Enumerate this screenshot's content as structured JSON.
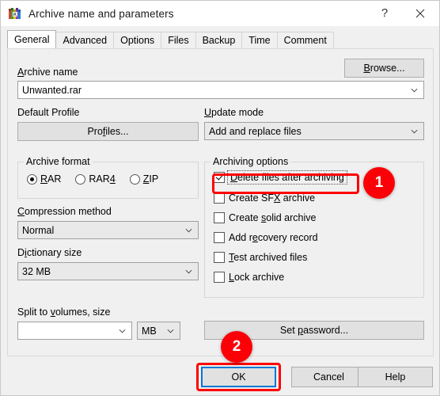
{
  "window": {
    "title": "Archive name and parameters",
    "icon": "winrar-books-icon",
    "help_button": "?",
    "close_button": "✕"
  },
  "tabs": [
    {
      "label": "General",
      "active": true
    },
    {
      "label": "Advanced",
      "active": false
    },
    {
      "label": "Options",
      "active": false
    },
    {
      "label": "Files",
      "active": false
    },
    {
      "label": "Backup",
      "active": false
    },
    {
      "label": "Time",
      "active": false
    },
    {
      "label": "Comment",
      "active": false
    }
  ],
  "archive_name": {
    "label": "Archive name",
    "value": "Unwanted.rar",
    "browse_button": "Browse..."
  },
  "default_profile": {
    "label": "Default Profile",
    "button": "Profiles..."
  },
  "update_mode": {
    "label": "Update mode",
    "value": "Add and replace files"
  },
  "archive_format": {
    "legend": "Archive format",
    "options": [
      {
        "label": "RAR",
        "selected": true
      },
      {
        "label": "RAR4",
        "selected": false
      },
      {
        "label": "ZIP",
        "selected": false
      }
    ]
  },
  "compression_method": {
    "label": "Compression method",
    "value": "Normal"
  },
  "dictionary_size": {
    "label": "Dictionary size",
    "value": "32 MB"
  },
  "split_volumes": {
    "label": "Split to volumes, size",
    "value": "",
    "unit": "MB"
  },
  "archiving_options": {
    "legend": "Archiving options",
    "items": [
      {
        "label": "Delete files after archiving",
        "checked": true,
        "focused": true
      },
      {
        "label": "Create SFX archive",
        "checked": false,
        "focused": false
      },
      {
        "label": "Create solid archive",
        "checked": false,
        "focused": false
      },
      {
        "label": "Add recovery record",
        "checked": false,
        "focused": false
      },
      {
        "label": "Test archived files",
        "checked": false,
        "focused": false
      },
      {
        "label": "Lock archive",
        "checked": false,
        "focused": false
      }
    ]
  },
  "set_password": {
    "button": "Set password..."
  },
  "footer": {
    "ok": "OK",
    "cancel": "Cancel",
    "help": "Help"
  },
  "annotations": {
    "badge_one": "1",
    "badge_two": "2",
    "highlight_color": "#ff0000"
  }
}
